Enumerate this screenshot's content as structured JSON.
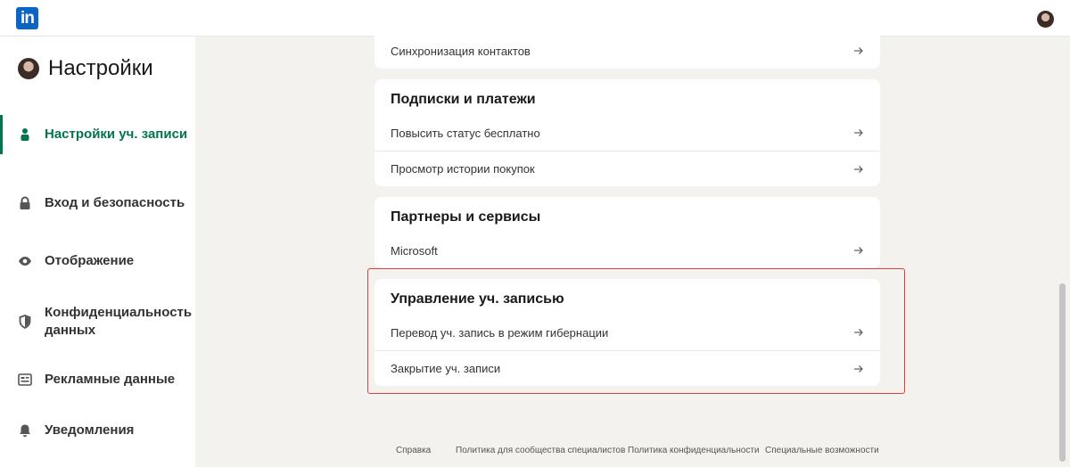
{
  "topbar": {
    "logo_text": "in"
  },
  "sidebar": {
    "title": "Настройки",
    "items": [
      {
        "label": "Настройки уч. записи",
        "icon": "person-icon",
        "active": true
      },
      {
        "label": "Вход и безопасность",
        "icon": "lock-icon"
      },
      {
        "label": "Отображение",
        "icon": "eye-icon"
      },
      {
        "label": "Конфиденциальность данных",
        "icon": "shield-icon"
      },
      {
        "label": "Рекламные данные",
        "icon": "ad-icon"
      },
      {
        "label": "Уведомления",
        "icon": "bell-icon"
      }
    ]
  },
  "cards": {
    "sync": {
      "rows": [
        "Синхронизация контактов"
      ]
    },
    "subscriptions": {
      "title": "Подписки и платежи",
      "rows": [
        "Повысить статус бесплатно",
        "Просмотр истории покупок"
      ]
    },
    "partners": {
      "title": "Партнеры и сервисы",
      "rows": [
        "Microsoft"
      ]
    },
    "account": {
      "title": "Управление уч. записью",
      "rows": [
        "Перевод уч. запись в режим гибернации",
        "Закрытие уч. записи"
      ]
    }
  },
  "footer": {
    "links": [
      "Справка",
      "Политика для сообщества специалистов",
      "Политика конфиденциальности",
      "Специальные возможности"
    ]
  },
  "colors": {
    "accent": "#01754f",
    "brand": "#0a66c2",
    "highlight": "#e43b3b"
  }
}
